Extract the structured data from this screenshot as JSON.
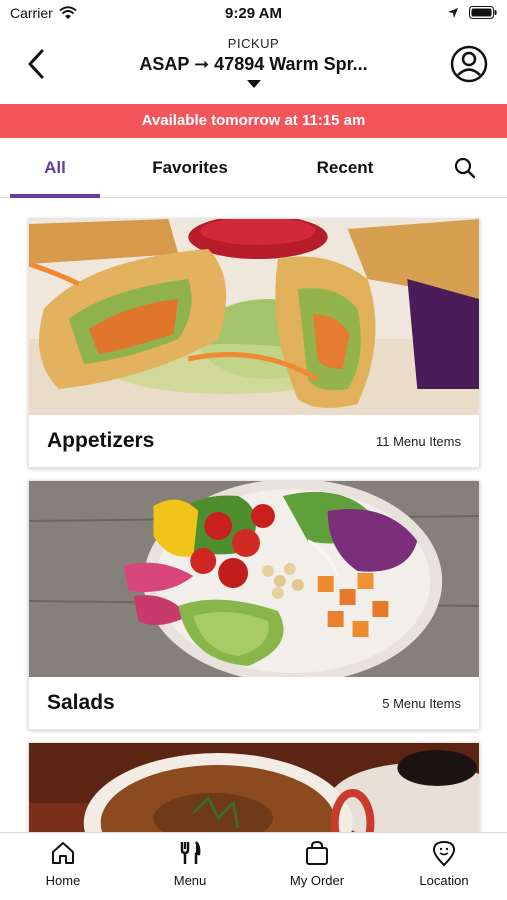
{
  "status_bar": {
    "carrier": "Carrier",
    "time": "9:29 AM"
  },
  "header": {
    "order_type": "PICKUP",
    "route": "ASAP ➞ 47894 Warm Spr..."
  },
  "banner": {
    "text": "Available tomorrow at 11:15 am",
    "color": "#f2565b"
  },
  "tabs": [
    {
      "label": "All",
      "active": true
    },
    {
      "label": "Favorites",
      "active": false
    },
    {
      "label": "Recent",
      "active": false
    }
  ],
  "accent_color": "#6a3aa3",
  "categories": [
    {
      "name": "Appetizers",
      "count": "11 Menu Items",
      "image": "spring-rolls-photo"
    },
    {
      "name": "Salads",
      "count": "5 Menu Items",
      "image": "salad-bowl-photo"
    },
    {
      "name": "",
      "count": "",
      "image": "soup-bowl-photo"
    }
  ],
  "bottom_nav": [
    {
      "label": "Home",
      "icon": "home-icon"
    },
    {
      "label": "Menu",
      "icon": "fork-knife-icon"
    },
    {
      "label": "My Order",
      "icon": "shopping-bag-icon"
    },
    {
      "label": "Location",
      "icon": "location-pin-icon"
    }
  ]
}
